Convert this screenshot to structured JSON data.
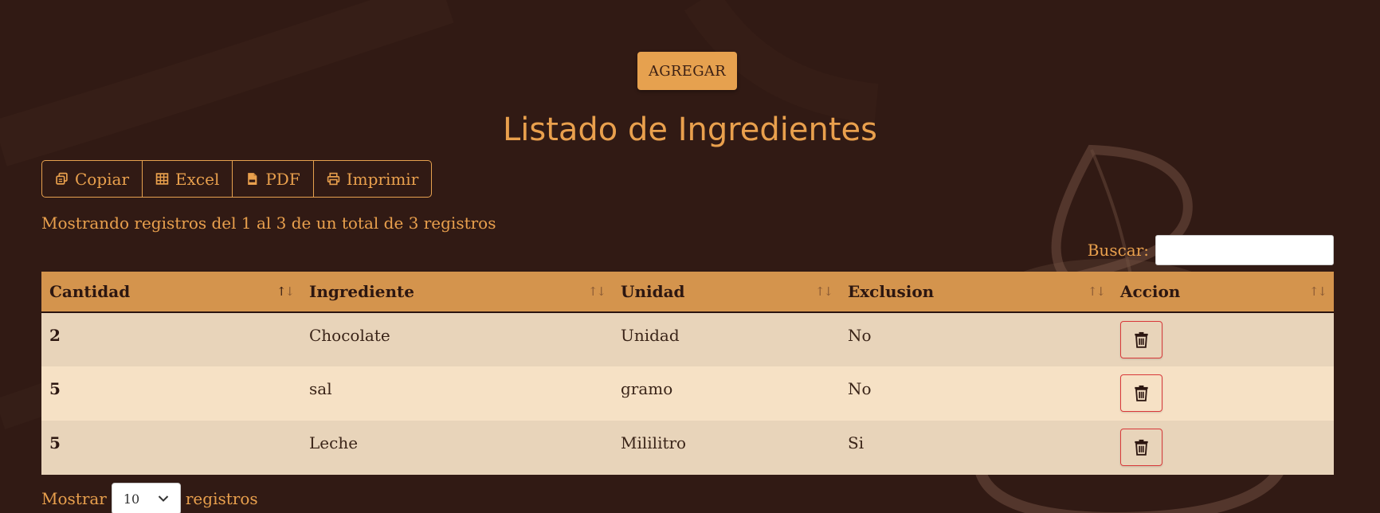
{
  "header": {
    "add_label": "AGREGAR",
    "title": "Listado de Ingredientes"
  },
  "export_buttons": [
    {
      "label": "Copiar",
      "icon": "copy-icon"
    },
    {
      "label": "Excel",
      "icon": "table-icon"
    },
    {
      "label": "PDF",
      "icon": "pdf-file-icon"
    },
    {
      "label": "Imprimir",
      "icon": "print-icon"
    }
  ],
  "info_text": "Mostrando registros del 1 al 3 de un total de 3 registros",
  "search": {
    "label": "Buscar:",
    "value": ""
  },
  "table": {
    "columns": [
      "Cantidad",
      "Ingrediente",
      "Unidad",
      "Exclusion",
      "Accion"
    ],
    "sorted_column": "Cantidad",
    "rows": [
      {
        "cantidad": "2",
        "ingrediente": "Chocolate",
        "unidad": "Unidad",
        "exclusion": "No"
      },
      {
        "cantidad": "5",
        "ingrediente": "sal",
        "unidad": "gramo",
        "exclusion": "No"
      },
      {
        "cantidad": "5",
        "ingrediente": "Leche",
        "unidad": "Mililitro",
        "exclusion": "Si"
      }
    ],
    "row_action_icon": "trash-icon"
  },
  "length_menu": {
    "prefix": "Mostrar",
    "value": "10",
    "suffix": "registros"
  },
  "colors": {
    "background": "#311a14",
    "accent": "#e6a14f",
    "header_row": "#d4944d",
    "row_odd": "#e8d4ba",
    "row_even": "#f6e1c5",
    "danger": "#d9393a"
  }
}
